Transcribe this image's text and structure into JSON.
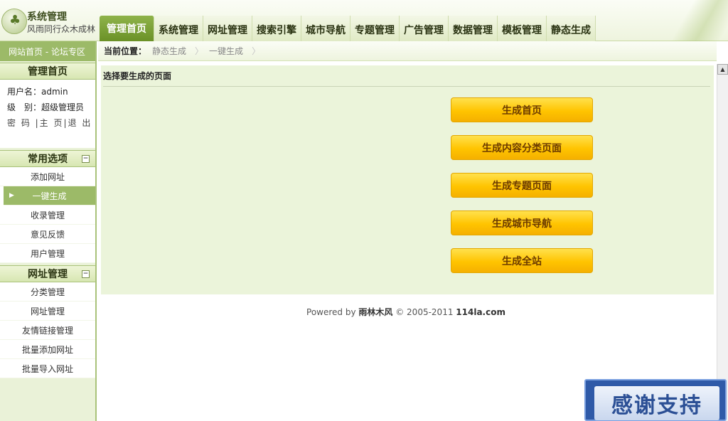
{
  "header": {
    "logo_title": "系统管理",
    "logo_sub": "风雨同行众木成林",
    "tabs": [
      "管理首页",
      "系统管理",
      "网址管理",
      "搜索引擎",
      "城市导航",
      "专题管理",
      "广告管理",
      "数据管理",
      "模板管理",
      "静态生成"
    ],
    "active_tab": "管理首页"
  },
  "sidebar": {
    "top_link": "网站首页 - 论坛专区",
    "home_title": "管理首页",
    "user": {
      "username_line": "用户名：admin",
      "level_line": "级　别：超级管理员",
      "links_line": "密 码 |主 页|退 出"
    },
    "groups": [
      {
        "title": "常用选项",
        "items": [
          "添加网址",
          "一键生成",
          "收录管理",
          "意见反馈",
          "用户管理"
        ]
      },
      {
        "title": "网址管理",
        "items": [
          "分类管理",
          "网址管理",
          "友情链接管理",
          "批量添加网址",
          "批量导入网址"
        ]
      }
    ],
    "active_item": "一键生成"
  },
  "main": {
    "crumb_label": "当前位置：",
    "crumbs": [
      "静态生成",
      "一键生成"
    ],
    "panel_title": "选择要生成的页面",
    "buttons": [
      "生成首页",
      "生成内容分类页面",
      "生成专题页面",
      "生成城市导航",
      "生成全站"
    ],
    "footer": {
      "prefix": "Powered by ",
      "brand": "雨林木风",
      "middle": " © 2005-2011 ",
      "site": "114la.com"
    }
  },
  "banner": {
    "text": "感谢支持"
  },
  "colors": {
    "accent_green": "#9cba68",
    "button_yellow": "#ffc400",
    "banner_blue": "#2f5aa8"
  }
}
